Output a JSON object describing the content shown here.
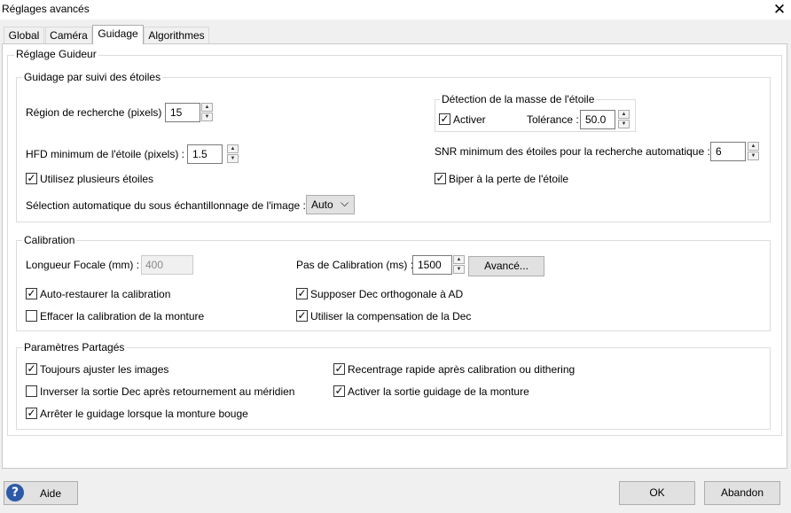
{
  "window": {
    "title": "Réglages avancés",
    "close_glyph": "✕"
  },
  "tabs": [
    {
      "label": "Global",
      "active": false
    },
    {
      "label": "Caméra",
      "active": false
    },
    {
      "label": "Guidage",
      "active": true
    },
    {
      "label": "Algorithmes",
      "active": false
    }
  ],
  "guider": {
    "legend": "Réglage Guideur",
    "star_tracking": {
      "legend": "Guidage par suivi des étoiles",
      "search_region_label": "Région de recherche (pixels) :",
      "search_region_value": "15",
      "hfd_label": "HFD minimum de l'étoile (pixels) :",
      "hfd_value": "1.5",
      "multi_star_label": "Utilisez plusieurs étoiles",
      "multi_star_checked": true,
      "subsample_label": "Sélection automatique du sous échantillonnage de l'image :",
      "subsample_value": "Auto",
      "mass_detection": {
        "legend": "Détection de la masse de l'étoile",
        "enable_label": "Activer",
        "enable_checked": true,
        "tolerance_label": "Tolérance :",
        "tolerance_value": "50.0"
      },
      "snr_label": "SNR minimum des étoiles pour la recherche automatique :",
      "snr_value": "6",
      "beep_label": "Biper à la perte de l'étoile",
      "beep_checked": true
    },
    "calibration": {
      "legend": "Calibration",
      "focal_label": "Longueur Focale (mm) :",
      "focal_value": "400",
      "step_label": "Pas de Calibration (ms) :",
      "step_value": "1500",
      "advanced_button": "Avancé...",
      "auto_restore_label": "Auto-restaurer la calibration",
      "auto_restore_checked": true,
      "clear_mount_label": "Effacer la calibration de la monture",
      "clear_mount_checked": false,
      "assume_orth_label": "Supposer Dec orthogonale à AD",
      "assume_orth_checked": true,
      "dec_comp_label": "Utiliser la compensation de la Dec",
      "dec_comp_checked": true
    },
    "shared": {
      "legend": "Paramètres Partagés",
      "always_scale_label": "Toujours ajuster les images",
      "always_scale_checked": true,
      "reverse_dec_label": "Inverser la sortie Dec après retournement au méridien",
      "reverse_dec_checked": false,
      "stop_guiding_label": "Arrêter le guidage lorsque la monture bouge",
      "stop_guiding_checked": true,
      "fast_recenter_label": "Recentrage rapide après calibration ou dithering",
      "fast_recenter_checked": true,
      "enable_output_label": "Activer la sortie guidage de la monture",
      "enable_output_checked": true
    }
  },
  "footer": {
    "help_label": "Aide",
    "help_icon_glyph": "?",
    "ok_label": "OK",
    "cancel_label": "Abandon"
  },
  "glyphs": {
    "spin_up": "▲",
    "spin_down": "▼",
    "dropdown": "⌵",
    "check": "✓"
  },
  "colors": {
    "help_icon": "#2d5aa8",
    "active_tab": "#ffffff",
    "panel": "#ffffff",
    "window_bg": "#f0f0f0"
  }
}
